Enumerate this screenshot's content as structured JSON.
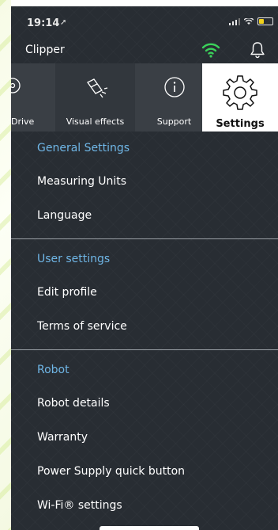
{
  "status": {
    "time": "19:14"
  },
  "header": {
    "title": "Clipper"
  },
  "tabs": [
    {
      "label": "Drive",
      "icon": "steering-icon"
    },
    {
      "label": "Visual effects",
      "icon": "sparkle-light-icon"
    },
    {
      "label": "Support",
      "icon": "info-icon"
    },
    {
      "label": "Settings",
      "icon": "gear-icon",
      "active": true
    }
  ],
  "menu": {
    "general": {
      "title": "General Settings",
      "items": [
        "Measuring Units",
        "Language"
      ]
    },
    "user": {
      "title": "User settings",
      "items": [
        "Edit profile",
        "Terms of service"
      ]
    },
    "robot": {
      "title": "Robot",
      "items": [
        "Robot details",
        "Warranty",
        "Power Supply quick button",
        "Wi-Fi® settings"
      ]
    }
  },
  "colors": {
    "accent": "#6fb6e6",
    "wifi": "#3bd25a",
    "panel": "#282d33"
  }
}
